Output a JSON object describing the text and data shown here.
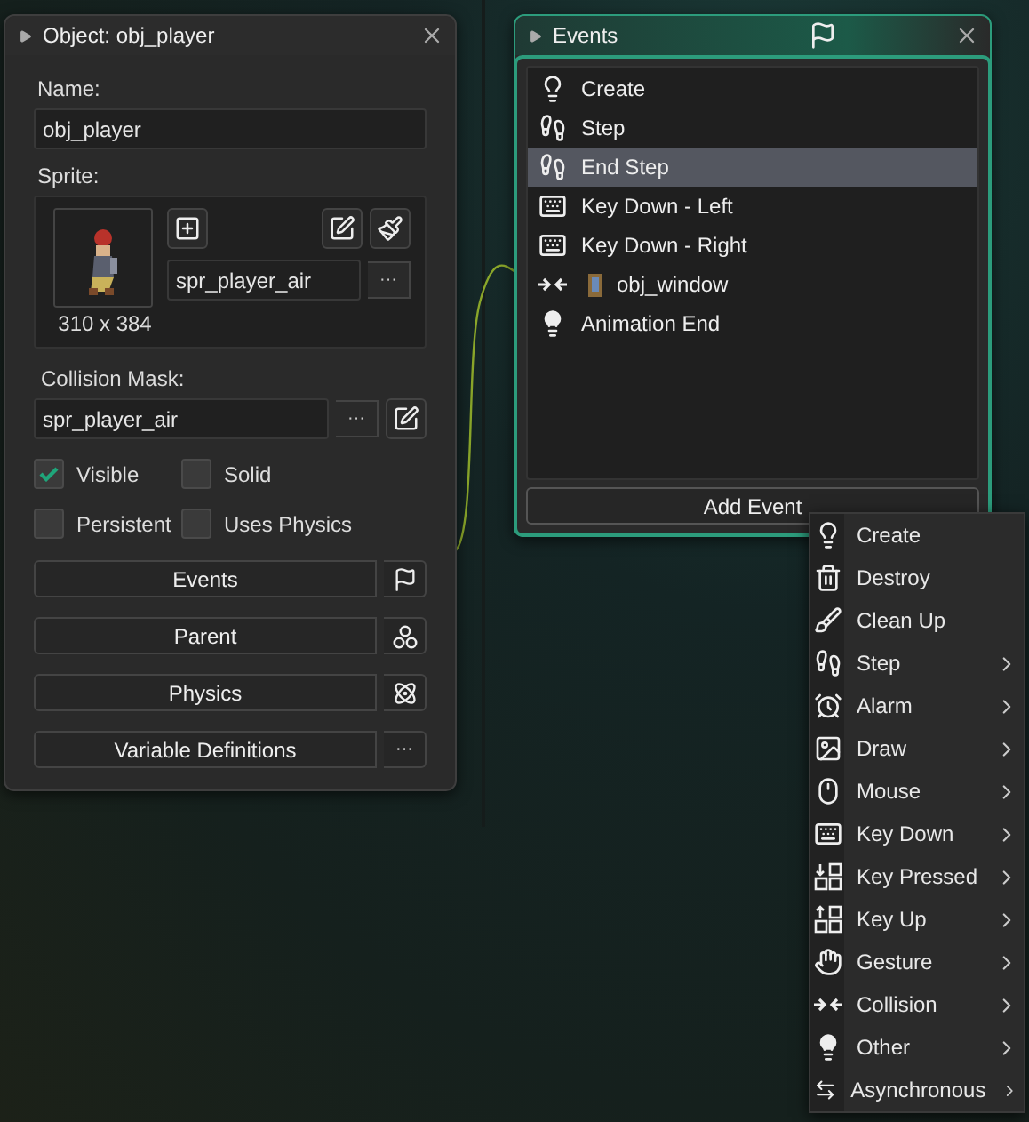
{
  "object_window": {
    "title": "Object: obj_player",
    "name_label": "Name:",
    "name_value": "obj_player",
    "sprite_label": "Sprite:",
    "sprite_size": "310 x 384",
    "sprite_value": "spr_player_air",
    "sprite_browse": "···",
    "mask_label": "Collision Mask:",
    "mask_value": "spr_player_air",
    "mask_browse": "···",
    "checkboxes": [
      {
        "label": "Visible",
        "checked": true
      },
      {
        "label": "Solid",
        "checked": false
      },
      {
        "label": "Persistent",
        "checked": false
      },
      {
        "label": "Uses Physics",
        "checked": false
      }
    ],
    "buttons": [
      {
        "label": "Events",
        "kind": "flag"
      },
      {
        "label": "Parent",
        "kind": "parent"
      },
      {
        "label": "Physics",
        "kind": "physics"
      },
      {
        "label": "Variable Definitions",
        "kind": "more",
        "more_text": "···"
      }
    ]
  },
  "events_window": {
    "title": "Events",
    "events": [
      {
        "label": "Create",
        "kind": "create",
        "selected": false
      },
      {
        "label": "Step",
        "kind": "step",
        "selected": false
      },
      {
        "label": "End Step",
        "kind": "step",
        "selected": true
      },
      {
        "label": "Key Down - Left",
        "kind": "keyboard",
        "selected": false
      },
      {
        "label": "Key Down - Right",
        "kind": "keyboard",
        "selected": false
      },
      {
        "label": "obj_window",
        "kind": "collision",
        "selected": false
      },
      {
        "label": "Animation End",
        "kind": "other",
        "selected": false
      }
    ],
    "add_button": "Add Event"
  },
  "add_event_menu": [
    {
      "label": "Create",
      "kind": "create",
      "submenu": false
    },
    {
      "label": "Destroy",
      "kind": "destroy",
      "submenu": false
    },
    {
      "label": "Clean Up",
      "kind": "cleanup",
      "submenu": false
    },
    {
      "label": "Step",
      "kind": "step",
      "submenu": true
    },
    {
      "label": "Alarm",
      "kind": "alarm",
      "submenu": true
    },
    {
      "label": "Draw",
      "kind": "draw",
      "submenu": true
    },
    {
      "label": "Mouse",
      "kind": "mouse",
      "submenu": true
    },
    {
      "label": "Key Down",
      "kind": "keyboard",
      "submenu": true
    },
    {
      "label": "Key Pressed",
      "kind": "keypressed",
      "submenu": true
    },
    {
      "label": "Key Up",
      "kind": "keyup",
      "submenu": true
    },
    {
      "label": "Gesture",
      "kind": "gesture",
      "submenu": true
    },
    {
      "label": "Collision",
      "kind": "collision",
      "submenu": true
    },
    {
      "label": "Other",
      "kind": "other",
      "submenu": true
    },
    {
      "label": "Asynchronous",
      "kind": "async",
      "submenu": true
    }
  ]
}
